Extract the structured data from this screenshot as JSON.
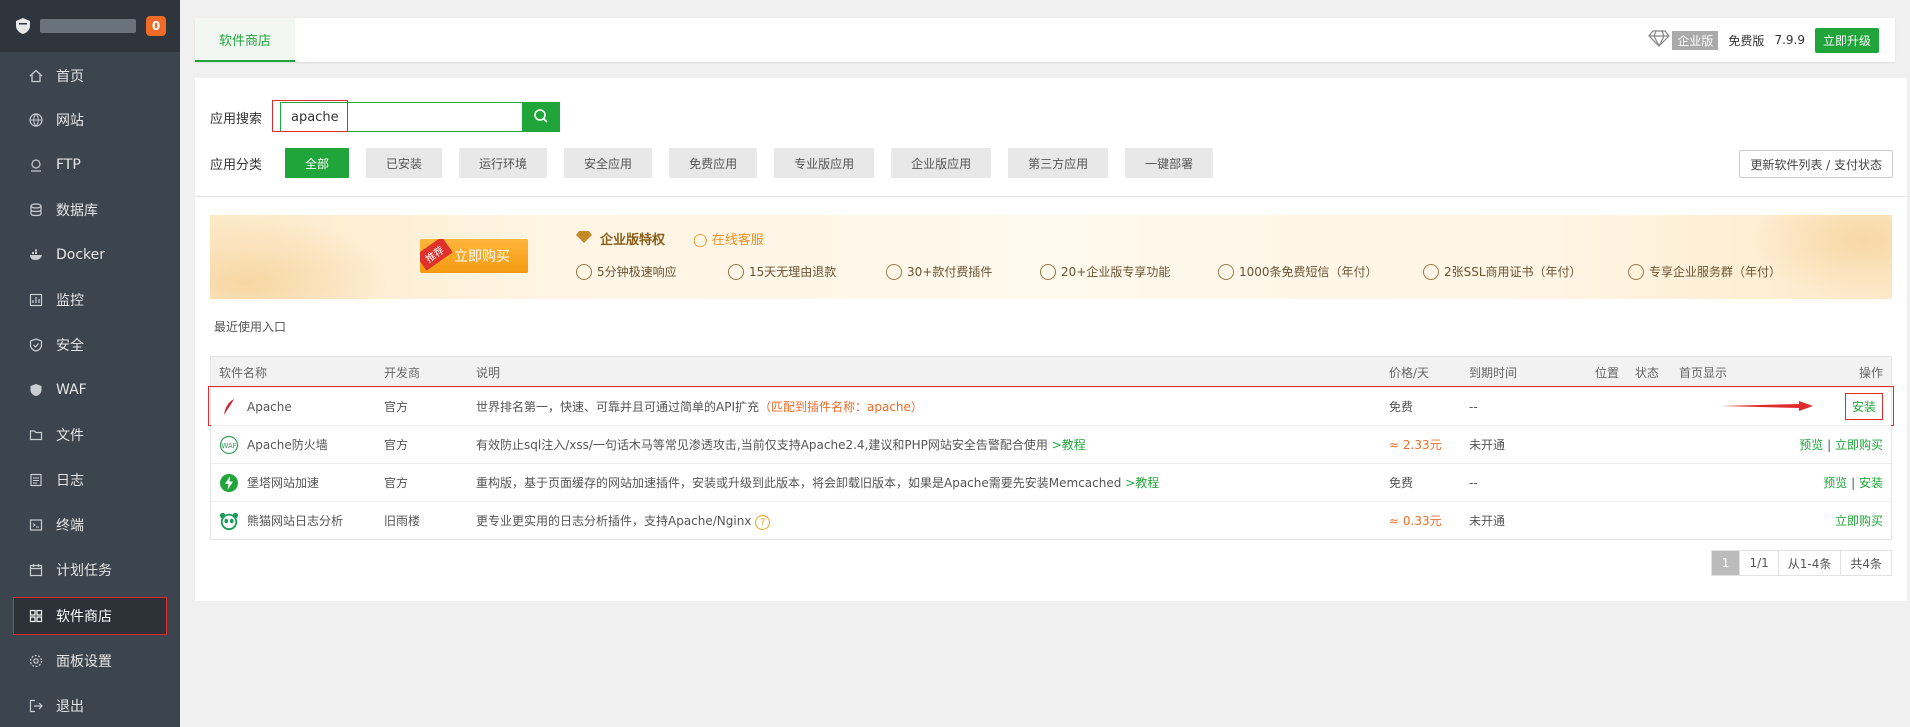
{
  "sidebar": {
    "badge": "0",
    "items": [
      {
        "label": "首页",
        "icon": "home-icon"
      },
      {
        "label": "网站",
        "icon": "globe-icon"
      },
      {
        "label": "FTP",
        "icon": "ftp-icon"
      },
      {
        "label": "数据库",
        "icon": "database-icon"
      },
      {
        "label": "Docker",
        "icon": "docker-icon"
      },
      {
        "label": "监控",
        "icon": "monitor-icon"
      },
      {
        "label": "安全",
        "icon": "shield-check-icon"
      },
      {
        "label": "WAF",
        "icon": "waf-shield-icon"
      },
      {
        "label": "文件",
        "icon": "folder-icon"
      },
      {
        "label": "日志",
        "icon": "log-icon"
      },
      {
        "label": "终端",
        "icon": "terminal-icon"
      },
      {
        "label": "计划任务",
        "icon": "calendar-icon"
      },
      {
        "label": "软件商店",
        "icon": "grid-icon"
      },
      {
        "label": "面板设置",
        "icon": "gear-icon"
      },
      {
        "label": "退出",
        "icon": "logout-icon"
      }
    ]
  },
  "topbar": {
    "tab": "软件商店",
    "enterprise": "企业版",
    "edition": "免费版",
    "version": "7.9.9",
    "upgrade": "立即升级"
  },
  "search": {
    "label": "应用搜索",
    "value": "apache"
  },
  "categories": {
    "label": "应用分类",
    "items": [
      "全部",
      "已安装",
      "运行环境",
      "安全应用",
      "免费应用",
      "专业版应用",
      "企业版应用",
      "第三方应用",
      "一键部署"
    ],
    "refresh": "更新软件列表 / 支付状态"
  },
  "banner": {
    "ribbon": "推荐",
    "buy": "立即购买",
    "title": "企业版特权",
    "online": "在线客服",
    "features": [
      "5分钟极速响应",
      "15天无理由退款",
      "30+款付费插件",
      "20+企业版专享功能",
      "1000条免费短信（年付）",
      "2张SSL商用证书（年付）",
      "专享企业服务群（年付）"
    ]
  },
  "recent": "最近使用入口",
  "table": {
    "headers": {
      "name": "软件名称",
      "dev": "开发商",
      "desc": "说明",
      "price": "价格/天",
      "expire": "到期时间",
      "pos": "位置",
      "status": "状态",
      "home": "首页显示",
      "op": "操作"
    },
    "rows": [
      {
        "name": "Apache",
        "dev": "官方",
        "desc": "世界排名第一，快速、可靠并且可通过简单的API扩充",
        "desc_extra": "（匹配到插件名称：apache）",
        "price": "免费",
        "expire": "--",
        "op1": "安装",
        "op2": ""
      },
      {
        "name": "Apache防火墙",
        "dev": "官方",
        "desc": "有效防止sql注入/xss/一句话木马等常见渗透攻击,当前仅支持Apache2.4,建议和PHP网站安全告警配合使用",
        "desc_extra": ">教程",
        "price": "≈ 2.33元",
        "expire": "未开通",
        "op1": "预览",
        "op2": "立即购买"
      },
      {
        "name": "堡塔网站加速",
        "dev": "官方",
        "desc": "重构版，基于页面缓存的网站加速插件，安装或升级到此版本，将会卸载旧版本，如果是Apache需要先安装Memcached",
        "desc_extra": ">教程",
        "price": "免费",
        "expire": "--",
        "op1": "预览",
        "op2": "安装"
      },
      {
        "name": "熊猫网站日志分析",
        "dev": "旧雨楼",
        "desc": "更专业更实用的日志分析插件，支持Apache/Nginx",
        "desc_extra": "?",
        "price": "≈ 0.33元",
        "expire": "未开通",
        "op1": "",
        "op2": "立即购买"
      }
    ]
  },
  "pager": {
    "current": "1",
    "pages": "1/1",
    "range": "从1-4条",
    "total": "共4条"
  }
}
